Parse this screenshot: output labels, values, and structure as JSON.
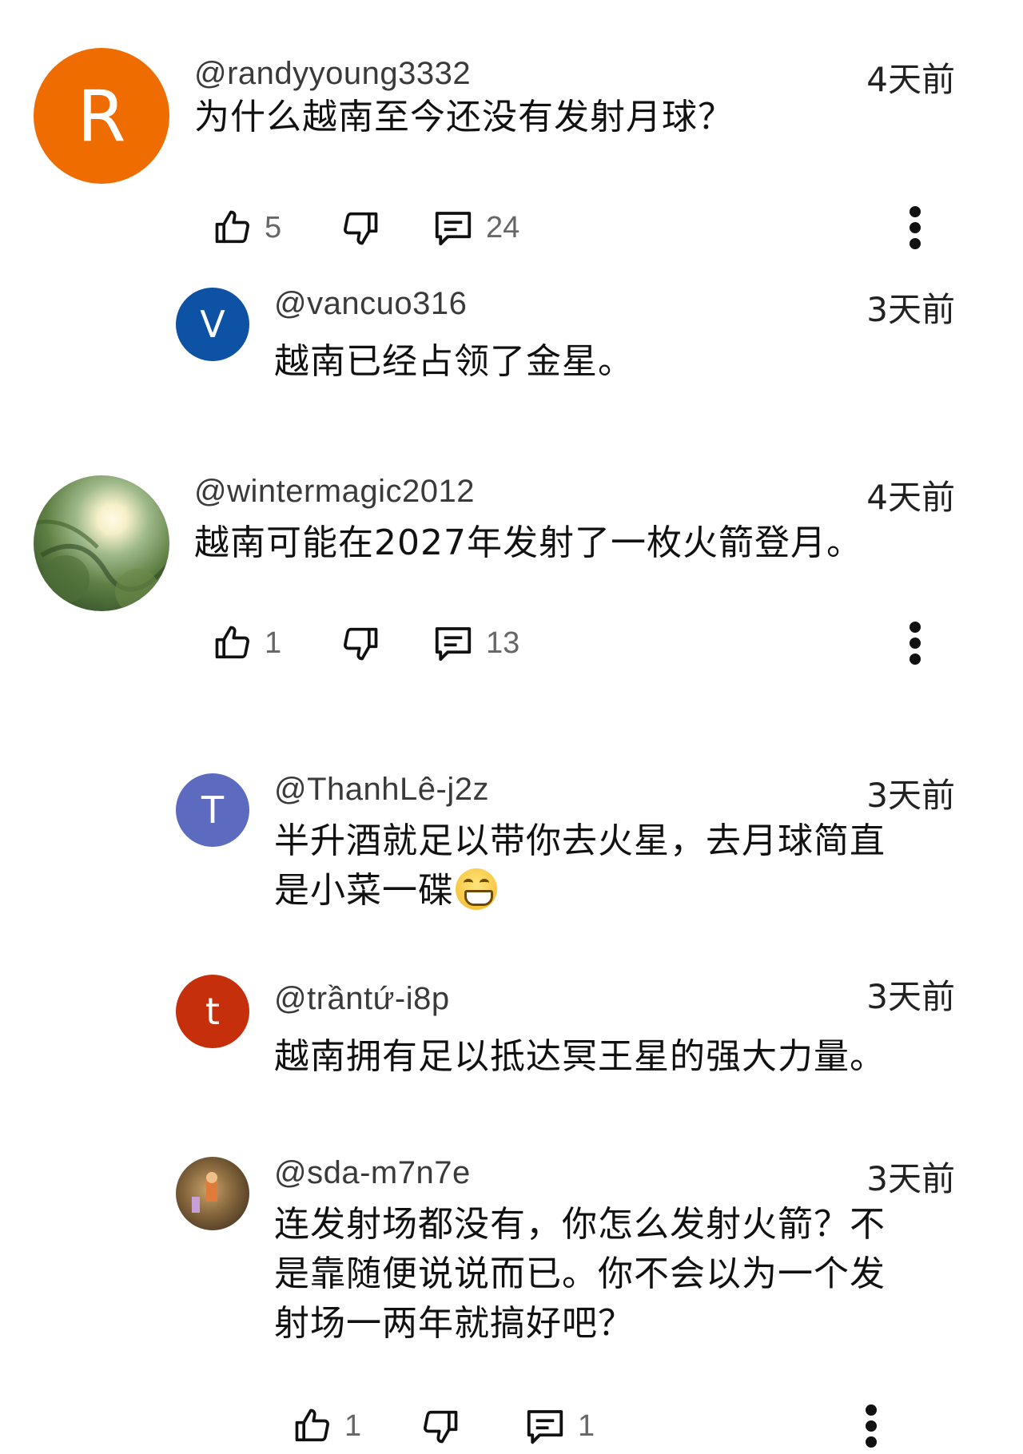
{
  "comments": [
    {
      "handle": "@randyyoung3332",
      "time": "4天前",
      "avatar_letter": "R",
      "avatar_color": "#ef6c00",
      "text": "为什么越南至今还没有发射月球？",
      "likes": "5",
      "replies": "24"
    },
    {
      "handle": "@vancuo316",
      "time": "3天前",
      "avatar_letter": "V",
      "avatar_color": "#0d52a4",
      "text": "越南已经占领了金星。"
    },
    {
      "handle": "@wintermagic2012",
      "time": "4天前",
      "text": "越南可能在2027年发射了一枚火箭登月。",
      "likes": "1",
      "replies": "13"
    },
    {
      "handle": "@ThanhLê-j2z",
      "time": "3天前",
      "avatar_letter": "T",
      "avatar_color": "#5c6bc0",
      "text_line1": "半升酒就足以带你去火星，去月球简直",
      "text_line2": "是小菜一碟"
    },
    {
      "handle": "@trầntứ-i8p",
      "time": "3天前",
      "avatar_letter": "t",
      "avatar_color": "#c62f0b",
      "text": "越南拥有足以抵达冥王星的强大力量。"
    },
    {
      "handle": "@sda-m7n7e",
      "time": "3天前",
      "text_line1": "连发射场都没有，你怎么发射火箭？不",
      "text_line2": "是靠随便说说而已。你不会以为一个发",
      "text_line3": "射场一两年就搞好吧？",
      "likes": "1",
      "replies": "1"
    }
  ],
  "icons": {
    "like": "thumbs-up-icon",
    "dislike": "thumbs-down-icon",
    "reply": "comment-icon",
    "more": "more-vert-icon",
    "emoji": "grinning-face-emoji"
  }
}
